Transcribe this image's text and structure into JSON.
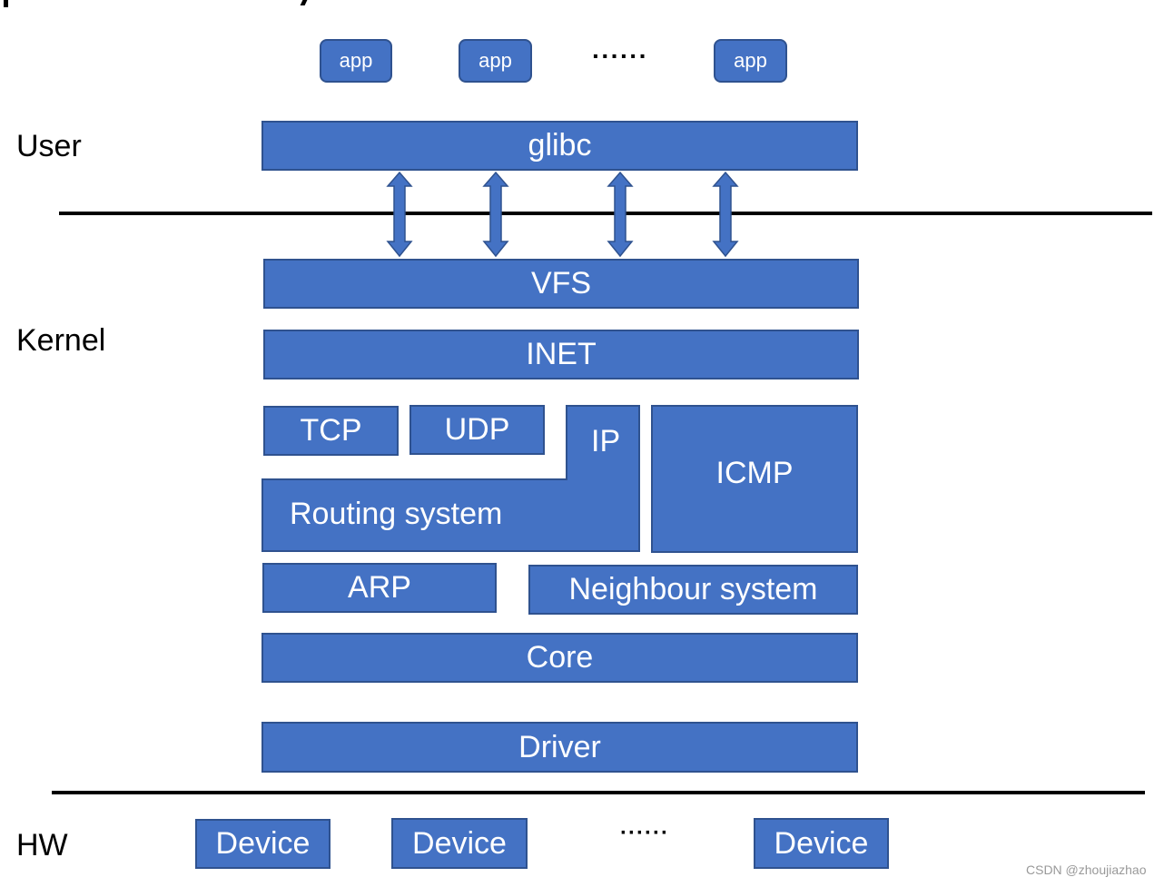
{
  "regions": {
    "user": "User",
    "kernel": "Kernel",
    "hw": "HW"
  },
  "apps": [
    "app",
    "app",
    "app"
  ],
  "apps_ellipsis": "······",
  "layers": {
    "glibc": "glibc",
    "vfs": "VFS",
    "inet": "INET",
    "tcp": "TCP",
    "udp": "UDP",
    "ip": "IP",
    "routing": "Routing system",
    "icmp": "ICMP",
    "arp": "ARP",
    "neighbour": "Neighbour system",
    "core": "Core",
    "driver": "Driver"
  },
  "devices": [
    "Device",
    "Device",
    "Device"
  ],
  "devices_ellipsis": "······",
  "syscall_arrows": 4,
  "colors": {
    "box_fill": "#4472c4",
    "box_border": "#2f528f",
    "text": "#ffffff",
    "line": "#000000"
  },
  "watermark": "CSDN @zhoujiazhao"
}
